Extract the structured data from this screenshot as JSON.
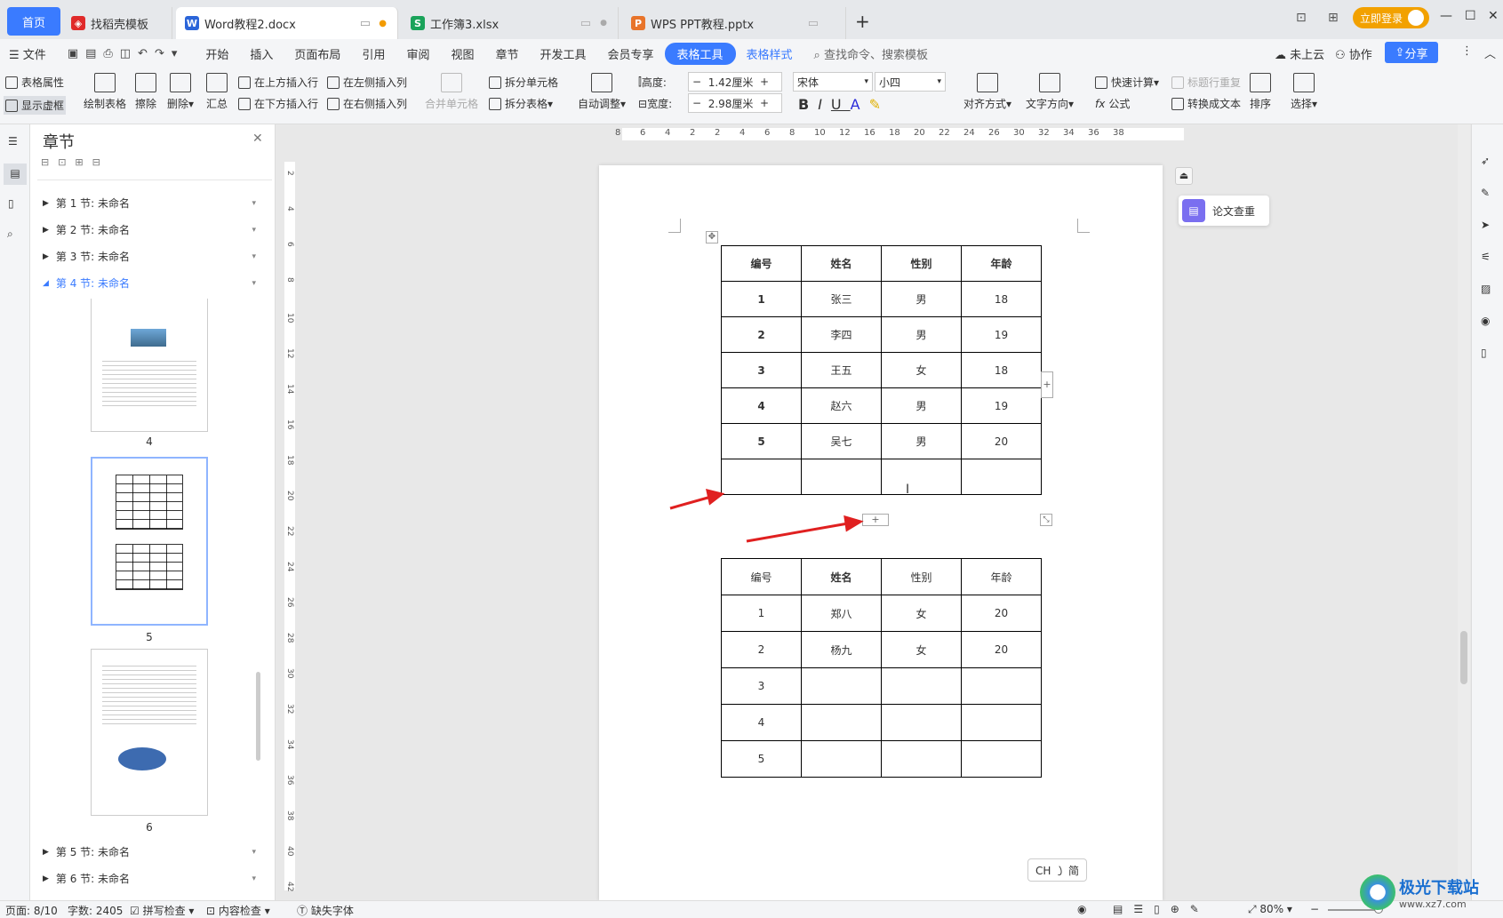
{
  "tabs": {
    "home": "首页",
    "items": [
      {
        "label": "找稻壳模板",
        "icon": "docer-icon"
      },
      {
        "label": "Word教程2.docx",
        "icon": "word-icon"
      },
      {
        "label": "工作簿3.xlsx",
        "icon": "excel-icon"
      },
      {
        "label": "WPS PPT教程.pptx",
        "icon": "ppt-icon"
      }
    ],
    "login": "立即登录"
  },
  "menu": {
    "file": "文件",
    "items": [
      "开始",
      "插入",
      "页面布局",
      "引用",
      "审阅",
      "视图",
      "章节",
      "开发工具",
      "会员专享"
    ],
    "table_tools": "表格工具",
    "table_style": "表格样式",
    "search": "查找命令、搜索模板",
    "cloud": "未上云",
    "collab": "协作",
    "share": "分享"
  },
  "toolbar": {
    "table_props": "表格属性",
    "show_grid": "显示虚框",
    "draw_table": "绘制表格",
    "erase": "擦除",
    "delete": "删除",
    "summary": "汇总",
    "insert_above": "在上方插入行",
    "insert_below": "在下方插入行",
    "insert_left": "在左侧插入列",
    "insert_right": "在右侧插入列",
    "merge": "合并单元格",
    "split_cell": "拆分单元格",
    "split_table": "拆分表格",
    "auto_adjust": "自动调整",
    "height_label": "高度:",
    "height_value": "1.42厘米",
    "width_label": "宽度:",
    "width_value": "2.98厘米",
    "font": "宋体",
    "size": "小四",
    "align": "对齐方式",
    "text_dir": "文字方向",
    "quick_calc": "快速计算",
    "header_repeat": "标题行重复",
    "formula": "公式",
    "to_text": "转换成文本",
    "sort": "排序",
    "select": "选择"
  },
  "nav": {
    "title": "章节",
    "sections_top": [
      "第 1 节: 未命名",
      "第 2 节: 未命名",
      "第 3 节: 未命名",
      "第 4 节: 未命名"
    ],
    "sections_bottom": [
      "第 5 节: 未命名",
      "第 6 节: 未命名"
    ],
    "pages": [
      "4",
      "5",
      "6"
    ]
  },
  "ruler": {
    "h_ticks": [
      "8",
      "6",
      "4",
      "2",
      "2",
      "4",
      "6",
      "8",
      "10",
      "12",
      "16",
      "18",
      "20",
      "22",
      "24",
      "26",
      "30",
      "32",
      "34",
      "36",
      "38"
    ],
    "v_ticks": [
      "2",
      "4",
      "6",
      "8",
      "10",
      "12",
      "14",
      "16",
      "18",
      "20",
      "22",
      "24",
      "26",
      "28",
      "30",
      "32",
      "34",
      "36",
      "38",
      "40",
      "42"
    ]
  },
  "table1": {
    "header": [
      "编号",
      "姓名",
      "性别",
      "年龄"
    ],
    "rows": [
      [
        "1",
        "张三",
        "男",
        "18"
      ],
      [
        "2",
        "李四",
        "男",
        "19"
      ],
      [
        "3",
        "王五",
        "女",
        "18"
      ],
      [
        "4",
        "赵六",
        "男",
        "19"
      ],
      [
        "5",
        "吴七",
        "男",
        "20"
      ],
      [
        "",
        "",
        "",
        ""
      ]
    ]
  },
  "table2": {
    "header": [
      "编号",
      "姓名",
      "性别",
      "年龄"
    ],
    "rows": [
      [
        "1",
        "郑八",
        "女",
        "20"
      ],
      [
        "2",
        "杨九",
        "女",
        "20"
      ],
      [
        "3",
        "",
        "",
        ""
      ],
      [
        "4",
        "",
        "",
        ""
      ],
      [
        "5",
        "",
        "",
        ""
      ]
    ]
  },
  "paper_check": "论文查重",
  "ime": "CH ㇁ 简",
  "status": {
    "page": "页面: 8/10",
    "words": "字数: 2405",
    "spell": "拼写检查",
    "content": "内容检查",
    "font_missing": "缺失字体",
    "zoom": "80%"
  },
  "watermark": "极光下载站",
  "watermark_url": "www.xz7.com",
  "colors": {
    "accent": "#3a7bff",
    "arrow": "#e02020",
    "login": "#f2a100"
  }
}
